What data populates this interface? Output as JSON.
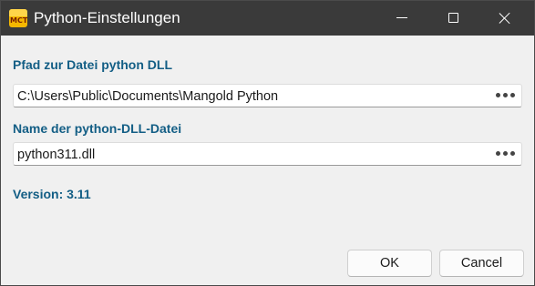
{
  "window": {
    "title": "Python-Einstellungen",
    "icon": "mangold-app-icon",
    "icon_text": "MCT"
  },
  "path_section": {
    "label": "Pfad zur Datei python DLL",
    "value": "C:\\Users\\Public\\Documents\\Mangold Python",
    "browse_icon": "ellipsis-icon"
  },
  "dll_section": {
    "label": "Name der python-DLL-Datei",
    "value": "python311.dll",
    "browse_icon": "ellipsis-icon"
  },
  "version": {
    "text": "Version: 3.11"
  },
  "buttons": {
    "ok_label": "OK",
    "cancel_label": "Cancel"
  },
  "colors": {
    "titlebar": "#3a3a3a",
    "label_accent": "#135e85",
    "window_bg": "#f0f0f0"
  }
}
